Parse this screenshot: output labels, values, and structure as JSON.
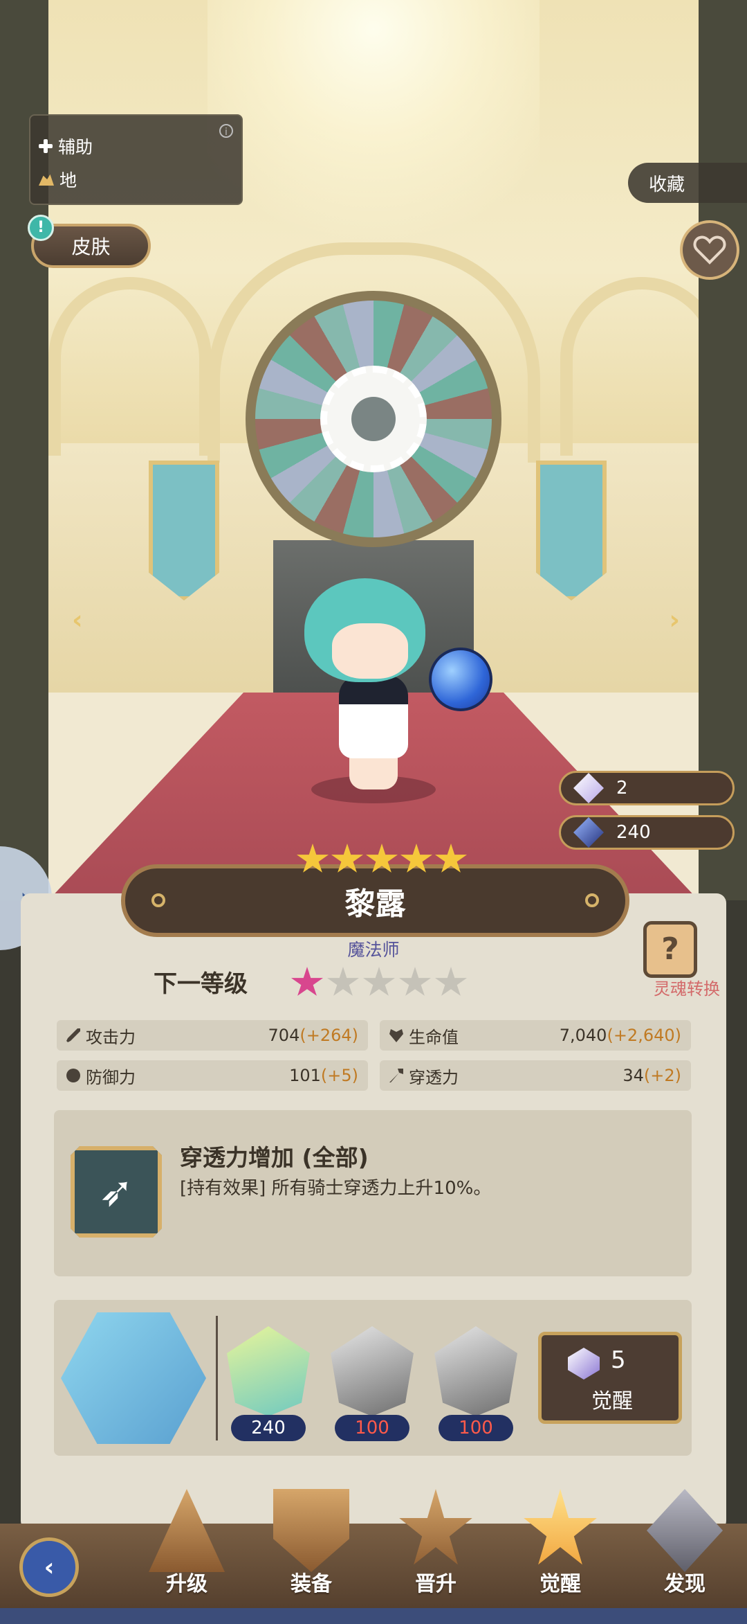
{
  "hero": {
    "role": "辅助",
    "element": "地",
    "name": "黎露",
    "class": "魔法师",
    "star_count": 5
  },
  "buttons": {
    "skin": "皮肤",
    "collect": "收藏",
    "soul_convert": "灵魂转换"
  },
  "resources": [
    {
      "icon": "crystal-icon",
      "value": "2"
    },
    {
      "icon": "blue-gem-icon",
      "value": "240"
    }
  ],
  "next_level": {
    "label": "下一等级",
    "filled_stars": 1,
    "total_stars": 5
  },
  "stats": [
    {
      "icon": "sword-icon",
      "label": "攻击力",
      "value": "704",
      "bonus": "(+264)"
    },
    {
      "icon": "heart-shield-icon",
      "label": "生命值",
      "value": "7,040",
      "bonus": "(+2,640)"
    },
    {
      "icon": "shield-icon",
      "label": "防御力",
      "value": "101",
      "bonus": "(+5)"
    },
    {
      "icon": "penetration-icon",
      "label": "穿透力",
      "value": "34",
      "bonus": "(+2)"
    }
  ],
  "skill": {
    "title": "穿透力增加 (全部)",
    "description": "[持有效果] 所有骑士穿透力上升10%。"
  },
  "awakening": {
    "materials": [
      {
        "type": "hero-shard",
        "count": "240"
      },
      {
        "type": "locked-shard",
        "count": "100"
      },
      {
        "type": "locked-shard",
        "count": "100"
      }
    ],
    "cost": "5",
    "button_label": "觉醒"
  },
  "bottom_nav": [
    {
      "label": "升级"
    },
    {
      "label": "装备"
    },
    {
      "label": "晋升"
    },
    {
      "label": "觉醒",
      "active": true
    },
    {
      "label": "发现"
    }
  ],
  "colors": {
    "accent_gold": "#c7a25c",
    "bonus_orange": "#c07a23",
    "shard_red": "#ff5a4a",
    "class_purple": "#55539a"
  }
}
